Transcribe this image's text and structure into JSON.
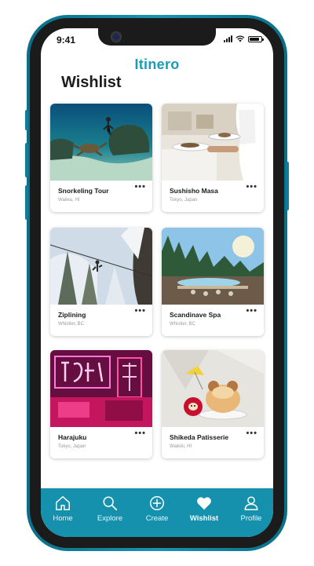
{
  "status": {
    "time": "9:41"
  },
  "app": {
    "logo": "Itinero",
    "page_title": "Wishlist"
  },
  "cards": [
    {
      "title": "Snorkeling Tour",
      "location": "Wailea, HI",
      "image": "underwater-turtle-photo"
    },
    {
      "title": "Sushisho Masa",
      "location": "Tokyo, Japan",
      "image": "restaurant-waiter-photo"
    },
    {
      "title": "Ziplining",
      "location": "Whistler, BC",
      "image": "snowy-forest-zipline-photo"
    },
    {
      "title": "Scandinave Spa",
      "location": "Whistler, BC",
      "image": "forest-spa-pool-photo"
    },
    {
      "title": "Harajuku",
      "location": "Tokyo, Japan",
      "image": "neon-signs-street-photo"
    },
    {
      "title": "Shikeda Patisserie",
      "location": "Waikiki, HI",
      "image": "cream-puff-dessert-photo"
    }
  ],
  "more_glyph": "•••",
  "tabbar": {
    "items": [
      {
        "label": "Home",
        "icon": "home-icon"
      },
      {
        "label": "Explore",
        "icon": "search-icon"
      },
      {
        "label": "Create",
        "icon": "plus-circle-icon"
      },
      {
        "label": "Wishlist",
        "icon": "heart-icon",
        "active": true
      },
      {
        "label": "Profile",
        "icon": "user-icon"
      }
    ]
  },
  "colors": {
    "brand": "#1a9cb6",
    "tabbar": "#1591ad",
    "frame": "#0d7e9a"
  }
}
